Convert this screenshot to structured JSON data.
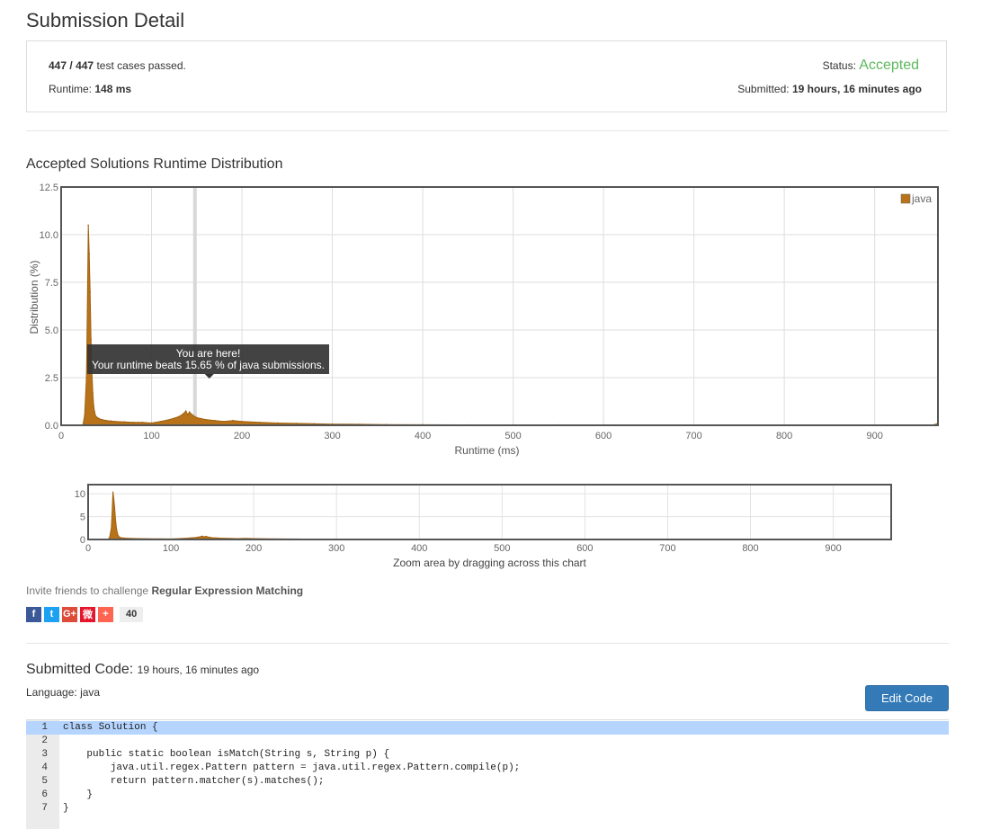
{
  "page": {
    "title": "Submission Detail"
  },
  "summary": {
    "passed": "447",
    "separator": "/",
    "total": "447",
    "passed_suffix": "test cases passed.",
    "runtime_label": "Runtime:",
    "runtime_value": "148 ms",
    "status_label": "Status:",
    "status_value": "Accepted",
    "submitted_label": "Submitted:",
    "submitted_value": "19 hours, 16 minutes ago"
  },
  "distribution": {
    "section_title": "Accepted Solutions Runtime Distribution",
    "tooltip_line1": "You are here!",
    "tooltip_line2": "Your runtime beats 15.65 % of java submissions.",
    "navigator_caption": "Zoom area by dragging across this chart"
  },
  "chart_data": {
    "type": "area",
    "title": "",
    "xlabel": "Runtime (ms)",
    "ylabel": "Distribution (%)",
    "xlim": [
      0,
      970
    ],
    "ylim": [
      0,
      12.5
    ],
    "x_ticks": [
      0,
      100,
      200,
      300,
      400,
      500,
      600,
      700,
      800,
      900
    ],
    "y_ticks": [
      "0.0",
      "2.5",
      "5.0",
      "7.5",
      "10.0",
      "12.5"
    ],
    "grid": true,
    "legend": {
      "position": "top-right",
      "entries": [
        "java"
      ]
    },
    "highlight_x": 148,
    "color": "#b8731a",
    "series": [
      {
        "name": "java",
        "x": [
          24,
          26,
          28,
          29,
          30,
          31,
          32,
          33,
          34,
          35,
          36,
          37,
          38,
          40,
          42,
          45,
          50,
          55,
          60,
          70,
          80,
          90,
          100,
          110,
          120,
          130,
          135,
          138,
          140,
          142,
          145,
          148,
          150,
          155,
          160,
          170,
          180,
          190,
          200,
          220,
          240,
          260,
          280,
          300,
          330,
          360,
          400,
          450,
          500,
          550,
          600,
          650,
          700,
          750,
          800,
          850,
          900,
          950,
          965,
          970
        ],
        "y": [
          0,
          0.5,
          2.5,
          6.0,
          10.5,
          9.0,
          7.0,
          4.5,
          2.8,
          1.7,
          1.0,
          0.7,
          0.5,
          0.4,
          0.35,
          0.3,
          0.25,
          0.22,
          0.2,
          0.18,
          0.15,
          0.15,
          0.12,
          0.2,
          0.3,
          0.45,
          0.6,
          0.75,
          0.55,
          0.7,
          0.55,
          0.45,
          0.4,
          0.35,
          0.3,
          0.25,
          0.2,
          0.25,
          0.2,
          0.15,
          0.12,
          0.1,
          0.08,
          0.06,
          0.05,
          0.04,
          0.03,
          0.02,
          0.02,
          0.02,
          0.02,
          0.01,
          0.01,
          0.01,
          0.01,
          0.01,
          0.01,
          0.01,
          0.02,
          0.1
        ]
      }
    ],
    "navigator": {
      "ylim": [
        0,
        12
      ],
      "y_ticks": [
        "0",
        "5",
        "10"
      ],
      "x_ticks": [
        0,
        100,
        200,
        300,
        400,
        500,
        600,
        700,
        800,
        900
      ]
    }
  },
  "invite": {
    "prefix": "Invite friends to challenge",
    "problem": "Regular Expression Matching",
    "share_count": "40",
    "share_buttons": [
      {
        "icon": "facebook-icon",
        "glyph": "f",
        "color": "#3b5998"
      },
      {
        "icon": "twitter-icon",
        "glyph": "t",
        "color": "#1da1f2"
      },
      {
        "icon": "google-plus-icon",
        "glyph": "G+",
        "color": "#dd4b39"
      },
      {
        "icon": "weibo-icon",
        "glyph": "微",
        "color": "#e6162d"
      },
      {
        "icon": "more-plus-icon",
        "glyph": "+",
        "color": "#ff6550"
      }
    ]
  },
  "code": {
    "title": "Submitted Code:",
    "time": "19 hours, 16 minutes ago",
    "language_label": "Language:",
    "language_value": "java",
    "edit_button": "Edit Code",
    "lines": [
      {
        "num": "1",
        "text": "class Solution {"
      },
      {
        "num": "2",
        "text": "    "
      },
      {
        "num": "3",
        "text": "    public static boolean isMatch(String s, String p) {"
      },
      {
        "num": "4",
        "text": "        java.util.regex.Pattern pattern = java.util.regex.Pattern.compile(p);"
      },
      {
        "num": "5",
        "text": "        return pattern.matcher(s).matches();"
      },
      {
        "num": "6",
        "text": "    }"
      },
      {
        "num": "7",
        "text": "}"
      }
    ]
  }
}
